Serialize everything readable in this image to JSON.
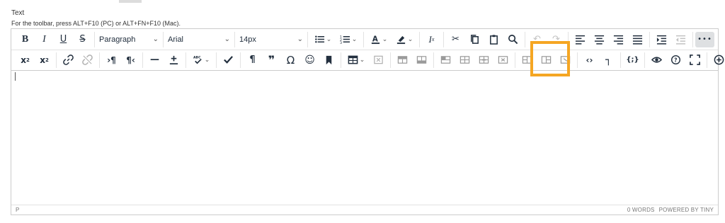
{
  "field": {
    "label": "Text",
    "hint": "For the toolbar, press ALT+F10 (PC) or ALT+FN+F10 (Mac)."
  },
  "toolbar": {
    "block_format": "Paragraph",
    "font_family": "Arial",
    "font_size": "14px",
    "more_label": "•••"
  },
  "statusbar": {
    "path": "P",
    "word_count": "0 WORDS",
    "powered_by": "POWERED BY TINY"
  },
  "colors": {
    "highlight": "#f5a623",
    "text_color_underline": "#222f3e",
    "active_button_bg": "#dee0e2"
  },
  "icons": {
    "row1": [
      "bold-icon",
      "italic-icon",
      "underline-icon",
      "strikethrough-icon",
      "bullet-list-icon",
      "numbered-list-icon",
      "text-color-icon",
      "highlight-color-icon",
      "clear-formatting-icon",
      "cut-icon",
      "copy-icon",
      "paste-icon",
      "find-replace-icon",
      "undo-icon",
      "redo-icon",
      "align-left-icon",
      "align-center-icon",
      "align-right-icon",
      "align-justify-icon",
      "indent-icon",
      "outdent-icon",
      "more-icon"
    ],
    "row2": [
      "superscript-icon",
      "subscript-icon",
      "link-icon",
      "unlink-icon",
      "ltr-icon",
      "rtl-icon",
      "horizontal-rule-icon",
      "insert-math-icon",
      "spellcheck-icon",
      "accessibility-check-icon",
      "paragraph-mark-icon",
      "blockquote-icon",
      "special-char-icon",
      "emoji-icon",
      "bookmark-icon",
      "table-icon",
      "delete-table-icon",
      "insert-row-before-icon",
      "insert-row-after-icon",
      "delete-row-icon",
      "insert-col-before-icon",
      "insert-col-after-icon",
      "delete-col-icon",
      "merge-cells-icon",
      "split-cells-icon",
      "cell-props-icon",
      "source-code-icon",
      "code-sample-icon",
      "template-icon",
      "preview-icon",
      "help-icon",
      "fullscreen-icon",
      "add-content-icon"
    ]
  }
}
